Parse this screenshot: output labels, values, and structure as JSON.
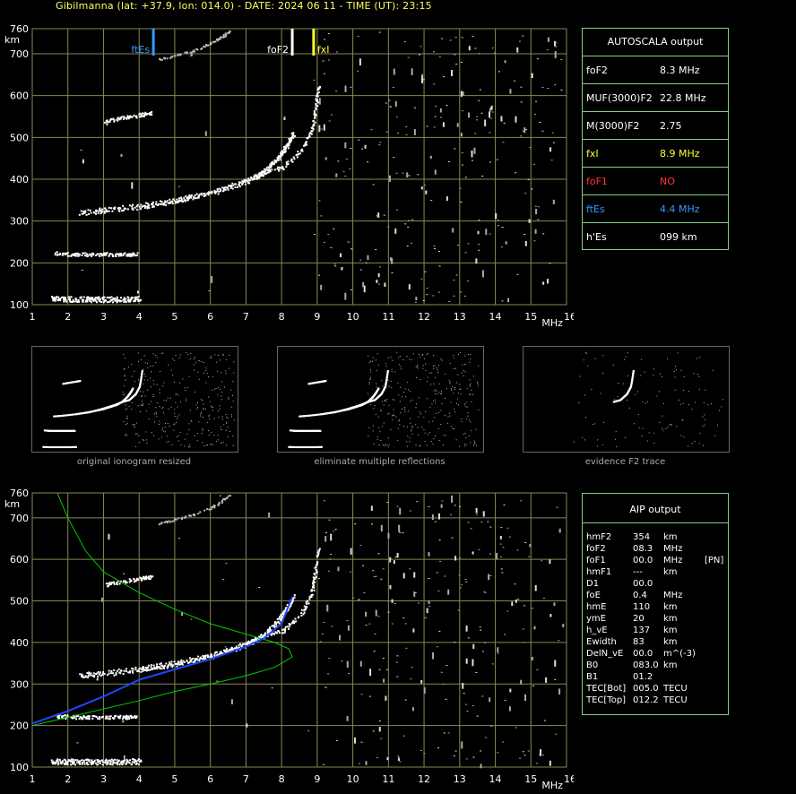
{
  "header": "Gibilmanna (lat: +37.9, lon: 014.0) - DATE: 2024 06 11 - TIME (UT): 23:15",
  "colors": {
    "grid": "#888855",
    "text": "#ffffff",
    "green": "#00cc00",
    "blue": "#2244ff",
    "fxi": "#ffff33",
    "foF1": "#ff3333",
    "ftEs": "#3399ff",
    "border": "#88cc88"
  },
  "chart_data": [
    {
      "type": "scatter",
      "name": "top-ionogram",
      "xlabel": "MHz",
      "ylabel": "km",
      "xlim": [
        1,
        16
      ],
      "ylim": [
        100,
        760
      ],
      "x_ticks": [
        "1",
        "2",
        "3",
        "4",
        "5",
        "6",
        "7",
        "8",
        "9",
        "10",
        "11",
        "12",
        "13",
        "14",
        "15",
        "16"
      ],
      "y_ticks": [
        "100",
        "200",
        "300",
        "400",
        "500",
        "600",
        "700",
        "760"
      ],
      "grid": true,
      "markers": [
        {
          "label": "ftEs",
          "x": 4.4,
          "color": "#3399ff"
        },
        {
          "label": "foF2",
          "x": 8.3,
          "color": "#ffffff"
        },
        {
          "label": "fxI",
          "x": 8.9,
          "color": "#ffff33"
        }
      ],
      "traces": {
        "es_trace": [
          [
            1.5,
            113
          ],
          [
            2,
            112
          ],
          [
            2.5,
            112
          ],
          [
            3,
            112
          ],
          [
            3.5,
            112
          ],
          [
            4,
            113
          ]
        ],
        "es_multiple": [
          [
            1.6,
            225
          ],
          [
            2,
            222
          ],
          [
            2.5,
            222
          ],
          [
            3,
            222
          ],
          [
            3.5,
            222
          ],
          [
            3.9,
            222
          ]
        ],
        "o_trace": [
          [
            2.3,
            320
          ],
          [
            3,
            325
          ],
          [
            4,
            335
          ],
          [
            5,
            350
          ],
          [
            6,
            367
          ],
          [
            7,
            395
          ],
          [
            7.5,
            420
          ],
          [
            7.9,
            455
          ],
          [
            8.1,
            480
          ],
          [
            8.3,
            510
          ]
        ],
        "x_trace": [
          [
            4,
            335
          ],
          [
            5,
            348
          ],
          [
            6,
            372
          ],
          [
            7,
            400
          ],
          [
            7.5,
            418
          ],
          [
            8,
            430
          ],
          [
            8.5,
            470
          ],
          [
            8.8,
            520
          ],
          [
            8.9,
            570
          ],
          [
            9,
            630
          ]
        ],
        "second_hop": [
          [
            3,
            540
          ],
          [
            3.5,
            548
          ],
          [
            4,
            555
          ],
          [
            4.3,
            560
          ]
        ],
        "upper_hop": [
          [
            4.5,
            690
          ],
          [
            5,
            700
          ],
          [
            5.5,
            712
          ],
          [
            6,
            730
          ],
          [
            6.3,
            745
          ],
          [
            6.5,
            758
          ]
        ]
      }
    },
    {
      "type": "scatter",
      "name": "bottom-ionogram",
      "xlabel": "MHz",
      "ylabel": "km",
      "xlim": [
        1,
        16
      ],
      "ylim": [
        100,
        760
      ],
      "x_ticks": [
        "1",
        "2",
        "3",
        "4",
        "5",
        "6",
        "7",
        "8",
        "9",
        "10",
        "11",
        "12",
        "13",
        "14",
        "15",
        "16"
      ],
      "y_ticks": [
        "100",
        "200",
        "300",
        "400",
        "500",
        "600",
        "700",
        "760"
      ],
      "grid": true,
      "profile_blue": [
        [
          1,
          205
        ],
        [
          2,
          235
        ],
        [
          3,
          270
        ],
        [
          4,
          310
        ],
        [
          5,
          335
        ],
        [
          6,
          360
        ],
        [
          7,
          390
        ],
        [
          7.5,
          410
        ],
        [
          8,
          445
        ],
        [
          8.3,
          510
        ]
      ],
      "green_upper": [
        [
          1.7,
          760
        ],
        [
          2,
          700
        ],
        [
          2.5,
          620
        ],
        [
          3,
          570
        ],
        [
          4,
          520
        ],
        [
          5,
          480
        ],
        [
          6,
          445
        ],
        [
          7,
          420
        ],
        [
          7.8,
          400
        ],
        [
          8.2,
          385
        ],
        [
          8.3,
          365
        ]
      ],
      "green_lower": [
        [
          1,
          200
        ],
        [
          2,
          220
        ],
        [
          3,
          240
        ],
        [
          4,
          260
        ],
        [
          5,
          282
        ],
        [
          6,
          300
        ],
        [
          7,
          320
        ],
        [
          7.8,
          340
        ],
        [
          8.3,
          365
        ]
      ]
    }
  ],
  "autoscala": {
    "title": "AUTOSCALA output",
    "rows": [
      {
        "key": "foF2",
        "value": "8.3 MHz",
        "color": "#ffffff"
      },
      {
        "key": "MUF(3000)F2",
        "value": "22.8 MHz",
        "color": "#ffffff"
      },
      {
        "key": "M(3000)F2",
        "value": "2.75",
        "color": "#ffffff"
      },
      {
        "key": "fxI",
        "value": "8.9 MHz",
        "color": "#ffff33"
      },
      {
        "key": "foF1",
        "value": "NO",
        "color": "#ff3333"
      },
      {
        "key": "ftEs",
        "value": "4.4 MHz",
        "color": "#3399ff"
      },
      {
        "key": "h'Es",
        "value": "099     km",
        "color": "#ffffff"
      }
    ]
  },
  "thumbnails": {
    "captions": [
      "original ionogram resized",
      "eliminate multiple reflections",
      "evidence F2 trace"
    ]
  },
  "aip": {
    "title": "AIP output",
    "rows": [
      [
        "hmF2",
        "354",
        "km",
        ""
      ],
      [
        "foF2",
        "08.3",
        "MHz",
        ""
      ],
      [
        "foF1",
        "00.0",
        "MHz",
        "[PN]"
      ],
      [
        "hmF1",
        "---",
        "km",
        ""
      ],
      [
        "D1",
        "00.0",
        "",
        ""
      ],
      [
        "foE",
        "0.4",
        "MHz",
        ""
      ],
      [
        "hmE",
        "110",
        "km",
        ""
      ],
      [
        "ymE",
        "20",
        "km",
        ""
      ],
      [
        "h_vE",
        "137",
        "km",
        ""
      ],
      [
        "Ewidth",
        "83",
        "km",
        ""
      ],
      [
        "DelN_vE",
        "00.0",
        "m^(-3)",
        ""
      ],
      [
        "B0",
        "083.0",
        "km",
        ""
      ],
      [
        "B1",
        "01.2",
        "",
        ""
      ],
      [
        "TEC[Bot]",
        "005.0",
        "TECU",
        ""
      ],
      [
        "TEC[Top]",
        "012.2",
        "TECU",
        ""
      ]
    ]
  }
}
